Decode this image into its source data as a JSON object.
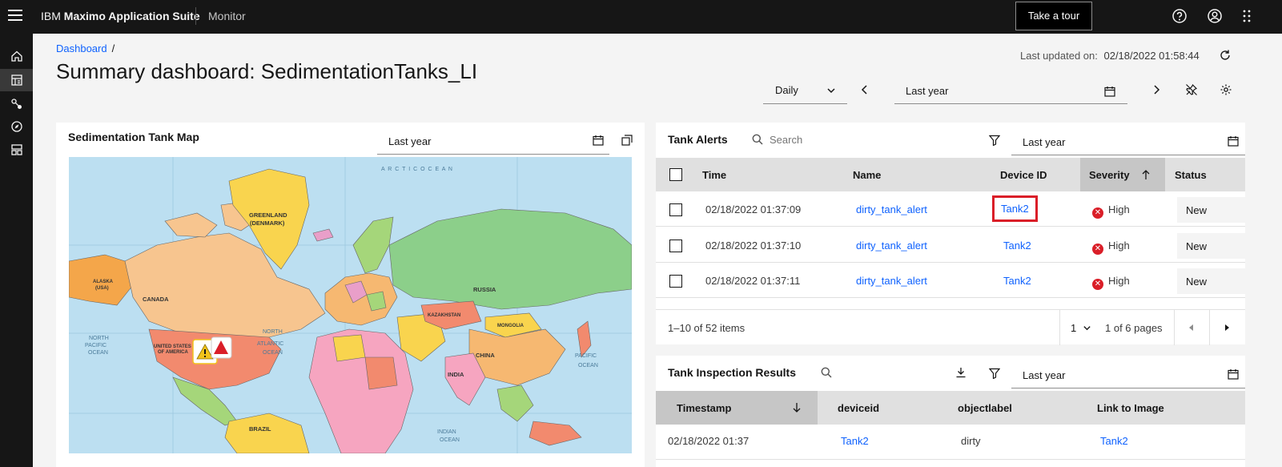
{
  "topbar": {
    "brand_prefix": "IBM",
    "brand_name": "Maximo Application Suite",
    "product": "Monitor",
    "tour_button": "Take a tour"
  },
  "icons": {
    "menu": "hamburger-icon",
    "help": "help-icon",
    "user": "user-icon",
    "apps": "app-switcher-icon",
    "rail": [
      "home-icon",
      "dashboard-icon",
      "devices-icon",
      "explore-icon",
      "setup-icon"
    ]
  },
  "header": {
    "breadcrumb": "Dashboard",
    "breadcrumb_sep": "/",
    "title": "Summary dashboard: SedimentationTanks_LI",
    "last_updated_label": "Last updated on:",
    "last_updated_value": "02/18/2022 01:58:44",
    "period": "Daily",
    "range": "Last year"
  },
  "map_panel": {
    "title": "Sedimentation Tank Map",
    "range": "Last year",
    "labels": {
      "arctic_ocean": "A R C T I C   O C E A N",
      "greenland": "GREENLAND",
      "denmark": "(DENMARK)",
      "russia": "RUSSIA",
      "canada": "CANADA",
      "alaska": "ALASKA",
      "usa": "(USA)",
      "united_states": "UNITED STATES",
      "of_america": "OF AMERICA",
      "north_pacific": "NORTH",
      "pacific": "PACIFIC",
      "ocean": "OCEAN",
      "north_atlantic": "NORTH",
      "atlantic": "ATLANTIC",
      "atlantic_ocean": "OCEAN",
      "china": "CHINA",
      "india": "INDIA",
      "mongolia": "MONGOLIA",
      "kazakhstan": "KAZAKHSTAN",
      "pacific_ocean_east": "PACIFIC",
      "pacific_ocean_east2": "OCEAN",
      "indian": "INDIAN",
      "indian_ocean": "OCEAN",
      "brazil": "BRAZIL"
    }
  },
  "alerts_panel": {
    "title": "Tank Alerts",
    "search_placeholder": "Search",
    "range": "Last year",
    "columns": [
      "Time",
      "Name",
      "Device ID",
      "Severity",
      "Status"
    ],
    "rows": [
      {
        "time": "02/18/2022 01:37:09",
        "name": "dirty_tank_alert",
        "device": "Tank2",
        "severity": "High",
        "status": "New"
      },
      {
        "time": "02/18/2022 01:37:10",
        "name": "dirty_tank_alert",
        "device": "Tank2",
        "severity": "High",
        "status": "New"
      },
      {
        "time": "02/18/2022 01:37:11",
        "name": "dirty_tank_alert",
        "device": "Tank2",
        "severity": "High",
        "status": "New"
      }
    ],
    "pager": {
      "items_text": "1–10 of 52 items",
      "page": "1",
      "pages_text": "1 of 6 pages"
    }
  },
  "inspection_panel": {
    "title": "Tank Inspection Results",
    "range": "Last year",
    "columns": [
      "Timestamp",
      "deviceid",
      "objectlabel",
      "Link to Image"
    ],
    "rows": [
      {
        "timestamp": "02/18/2022 01:37",
        "deviceid": "Tank2",
        "objectlabel": "dirty",
        "link": "Tank2"
      }
    ]
  },
  "colors": {
    "shell": "#161616",
    "link": "#0f62fe",
    "danger": "#da1e28",
    "ocean": "#bcdff1"
  }
}
